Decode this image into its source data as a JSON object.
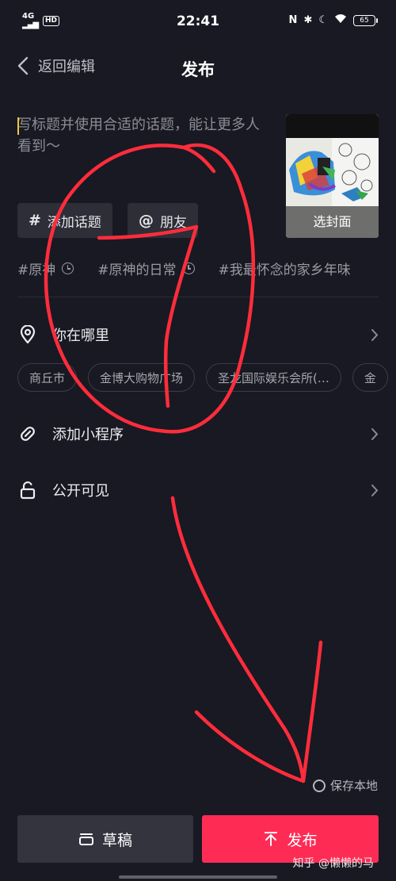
{
  "status_bar": {
    "time": "22:41",
    "network": "4G",
    "hd": "HD",
    "battery": "65",
    "icons": [
      "nfc-icon",
      "bluetooth-icon",
      "moon-icon",
      "wifi-icon",
      "battery-icon"
    ]
  },
  "header": {
    "back_label": "返回编辑",
    "title": "发布"
  },
  "caption": {
    "placeholder": "写标题并使用合适的话题，能让更多人看到～"
  },
  "cover": {
    "label": "选封面"
  },
  "chips": {
    "topic_symbol": "#",
    "topic_label": "添加话题",
    "friend_symbol": "@",
    "friend_label": "朋友"
  },
  "hashtags": [
    "#原神",
    "#原神的日常",
    "#我最怀念的家乡年味"
  ],
  "location": {
    "label": "你在哪里",
    "suggestions": [
      "商丘市",
      "金博大购物广场",
      "圣龙国际娱乐会所(…",
      "金"
    ]
  },
  "mini_program": {
    "label": "添加小程序"
  },
  "visibility": {
    "label": "公开可见"
  },
  "save_local": {
    "label": "保存本地"
  },
  "buttons": {
    "draft": "草稿",
    "publish": "发布"
  },
  "watermark": "知乎 @懒懒的马",
  "annotation": {
    "number": "7"
  },
  "colors": {
    "background": "#181923",
    "accent": "#fe2c55",
    "annotation": "#ff2d3b"
  }
}
